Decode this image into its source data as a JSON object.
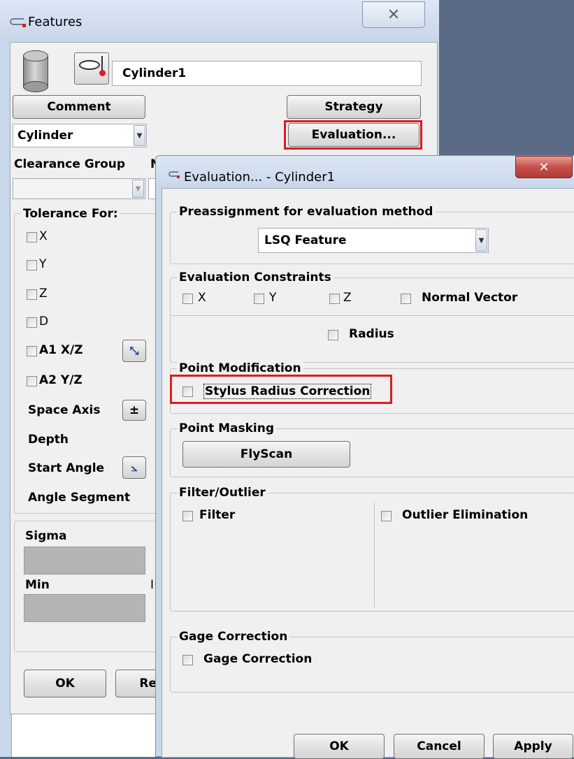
{
  "colors": {
    "desktop": "#5b6b86",
    "window_frame": "#c9d7ea",
    "panel": "#f0f0f0",
    "highlight": "#e01a24",
    "close_red": "#c75050"
  },
  "features": {
    "title": "Features",
    "name_value": "Cylinder1",
    "comment_label": "Comment",
    "strategy_label": "Strategy",
    "evaluation_label": "Evaluation...",
    "type_value": "Cylinder",
    "clearance_group_label": "Clearance Group",
    "clearance_suffix": "N",
    "tolerance_for_title": "Tolerance For:",
    "tol_x": "X",
    "tol_y": "Y",
    "tol_z": "Z",
    "tol_d": "D",
    "tol_a1": "A1 X/Z",
    "tol_a2": "A2 Y/Z",
    "space_axis": "Space Axis",
    "space_axis_btn": "±",
    "depth": "Depth",
    "start_angle": "Start Angle",
    "angle_segment": "Angle Segment",
    "sigma": "Sigma",
    "min": "Min",
    "min_suffix": "I",
    "ok_label": "OK",
    "re_label": "Re"
  },
  "evaluation": {
    "title": "Evaluation... - Cylinder1",
    "preassignment_title": "Preassignment for evaluation method",
    "method_value": "LSQ Feature",
    "constraints_title": "Evaluation Constraints",
    "c_x": "X",
    "c_y": "Y",
    "c_z": "Z",
    "c_normal": "Normal Vector",
    "c_radius": "Radius",
    "point_mod_title": "Point Modification",
    "stylus_radius": "Stylus Radius Correction",
    "point_masking_title": "Point Masking",
    "flyscan_label": "FlyScan",
    "filter_title": "Filter/Outlier",
    "filter_label": "Filter",
    "outlier_label": "Outlier Elimination",
    "gage_title": "Gage Correction",
    "gage_label": "Gage Correction",
    "ok_label": "OK",
    "cancel_label": "Cancel",
    "apply_label": "Apply"
  }
}
